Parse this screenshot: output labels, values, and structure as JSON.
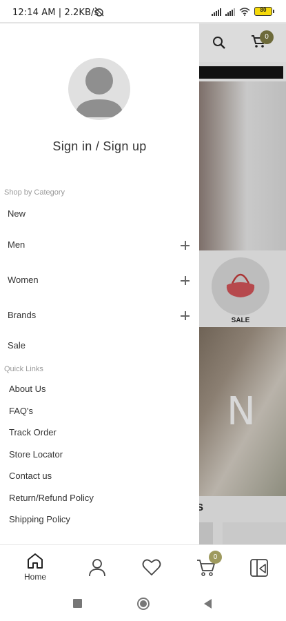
{
  "status_bar": {
    "time_info": "12:14 AM | 2.2KB/s",
    "battery": "80"
  },
  "drawer": {
    "sign_in_label": "Sign in / Sign up",
    "shop_section_label": "Shop by Category",
    "categories": [
      {
        "label": "New",
        "expandable": false
      },
      {
        "label": "Men",
        "expandable": true
      },
      {
        "label": "Women",
        "expandable": true
      },
      {
        "label": "Brands",
        "expandable": true
      },
      {
        "label": "Sale",
        "expandable": false
      }
    ],
    "quick_links_label": "Quick Links",
    "quick_links": [
      "About Us",
      "FAQ's",
      "Track Order",
      "Store Locator",
      "Contact us",
      "Return/Refund Policy",
      "Shipping Policy"
    ]
  },
  "background": {
    "cart_count": "0",
    "sale_label": "SALE",
    "hero_letters": "N",
    "strip_text": "S"
  },
  "bottom_nav": {
    "home_label": "Home",
    "cart_count": "0"
  },
  "icons": {
    "home": "home-icon",
    "account": "user-icon",
    "wishlist": "heart-icon",
    "cart": "cart-icon",
    "more": "menu-grid-icon",
    "search": "search-icon"
  }
}
